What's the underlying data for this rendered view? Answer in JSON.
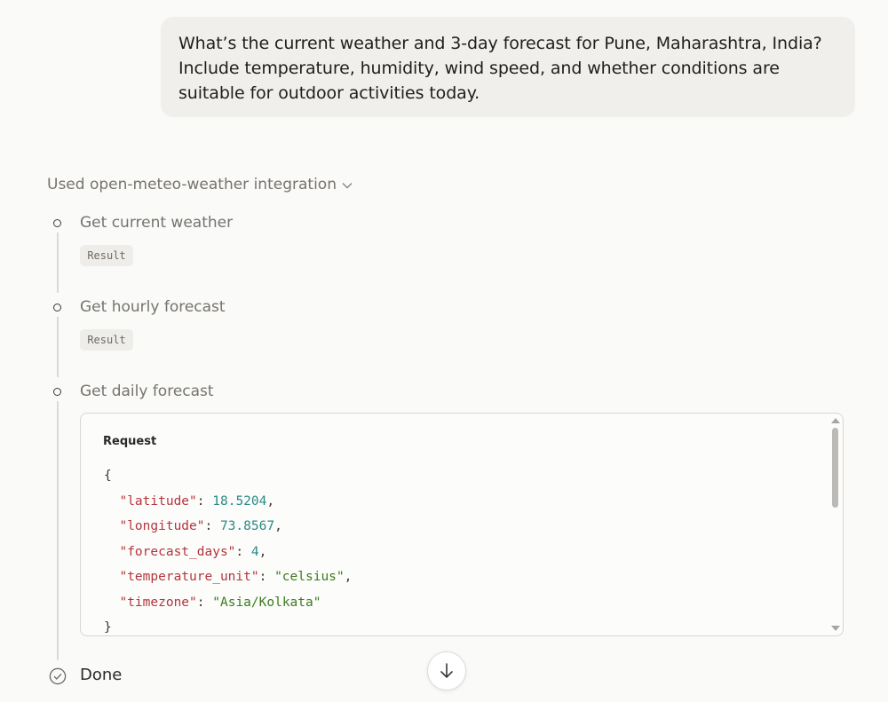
{
  "user_message": "What’s the current weather and 3-day forecast for Pune, Maharashtra, India? Include temperature, humidity, wind speed, and whether conditions are suitable for outdoor activities today.",
  "integration": {
    "label": "Used open-meteo-weather integration",
    "icon": "chevron-down-icon"
  },
  "steps": [
    {
      "label": "Get current weather",
      "chip": "Result"
    },
    {
      "label": "Get hourly forecast",
      "chip": "Result"
    },
    {
      "label": "Get daily forecast"
    }
  ],
  "request": {
    "title": "Request",
    "open_brace": "{",
    "close_brace": "}",
    "fields": [
      {
        "key": "\"latitude\"",
        "value": "18.5204",
        "type": "number"
      },
      {
        "key": "\"longitude\"",
        "value": "73.8567",
        "type": "number"
      },
      {
        "key": "\"forecast_days\"",
        "value": "4",
        "type": "number"
      },
      {
        "key": "\"temperature_unit\"",
        "value": "\"celsius\"",
        "type": "string"
      },
      {
        "key": "\"timezone\"",
        "value": "\"Asia/Kolkata\"",
        "type": "string"
      }
    ]
  },
  "done_label": "Done",
  "colors": {
    "key": "#b4363b",
    "number": "#2a8a85",
    "string": "#3c7a1a"
  }
}
